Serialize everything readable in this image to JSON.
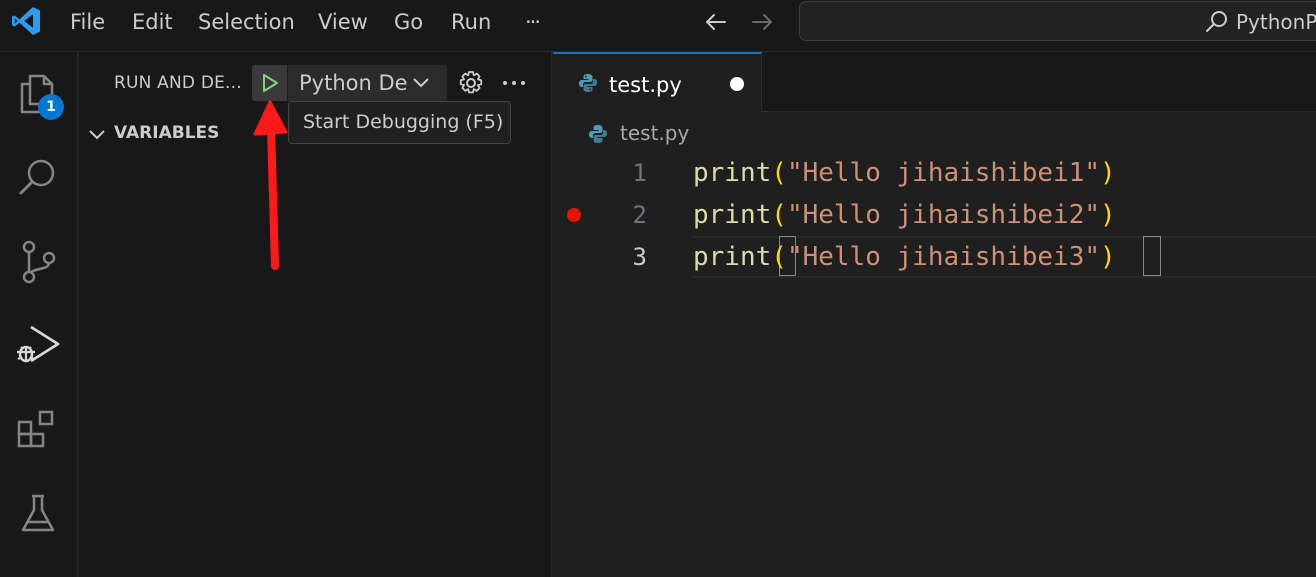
{
  "titlebar": {
    "menu": [
      "File",
      "Edit",
      "Selection",
      "View",
      "Go",
      "Run",
      "···"
    ],
    "search_text": "PythonPr"
  },
  "activitybar": {
    "icons": [
      "explorer-icon",
      "search-icon",
      "source-control-icon",
      "run-debug-icon",
      "extensions-icon",
      "testing-icon"
    ],
    "explorer_badge": "1"
  },
  "sidebar": {
    "title": "RUN AND DE...",
    "config_name": "Python De",
    "tooltip": "Start Debugging (F5)",
    "section": "VARIABLES"
  },
  "editor": {
    "tab": {
      "label": "test.py",
      "dirty": true
    },
    "breadcrumb": "test.py",
    "lines": [
      {
        "number": "1",
        "fn": "print",
        "open": "(",
        "str": "\"Hello jihaishibei1\"",
        "close": ")",
        "breakpoint": false,
        "current": false
      },
      {
        "number": "2",
        "fn": "print",
        "open": "(",
        "str": "\"Hello jihaishibei2\"",
        "close": ")",
        "breakpoint": true,
        "current": false
      },
      {
        "number": "3",
        "fn": "print",
        "open": "(",
        "str": "\"Hello jihaishibei3\"",
        "close": ")",
        "breakpoint": false,
        "current": true
      }
    ]
  },
  "colors": {
    "accent": "#0078d4",
    "breakpoint": "#e51400",
    "run_green": "#89d185",
    "annotation_arrow": "#ff1a1a",
    "string": "#ce9178",
    "function": "#dcdcaa",
    "bracket": "#ffd700"
  }
}
